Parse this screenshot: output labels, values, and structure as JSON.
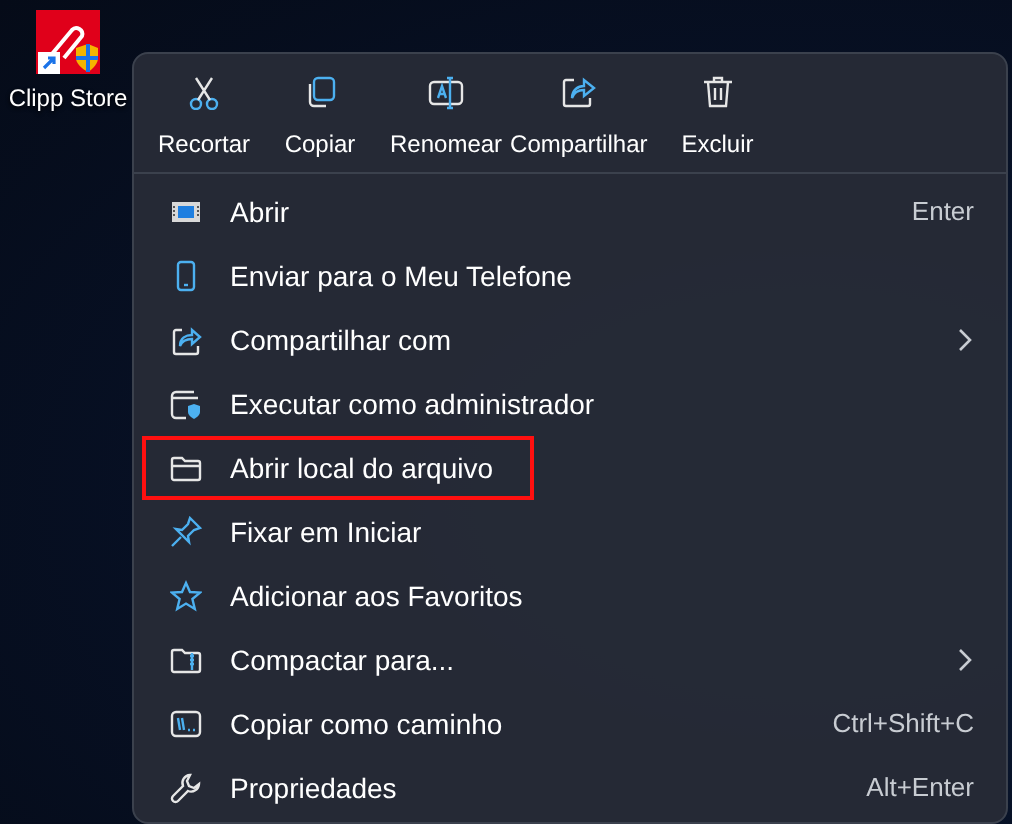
{
  "desktop_icon": {
    "label": "Clipp Store"
  },
  "toolbar": [
    {
      "label": "Recortar"
    },
    {
      "label": "Copiar"
    },
    {
      "label": "Renomear"
    },
    {
      "label": "Compartilhar"
    },
    {
      "label": "Excluir"
    }
  ],
  "menu_items": [
    {
      "label": "Abrir",
      "shortcut": "Enter",
      "submenu": false,
      "highlighted": false
    },
    {
      "label": "Enviar para o Meu Telefone",
      "submenu": false,
      "highlighted": false
    },
    {
      "label": "Compartilhar com",
      "submenu": true,
      "highlighted": false
    },
    {
      "label": "Executar como administrador",
      "submenu": false,
      "highlighted": false
    },
    {
      "label": "Abrir local do arquivo",
      "submenu": false,
      "highlighted": true
    },
    {
      "label": "Fixar em Iniciar",
      "submenu": false,
      "highlighted": false
    },
    {
      "label": "Adicionar aos Favoritos",
      "submenu": false,
      "highlighted": false
    },
    {
      "label": "Compactar para...",
      "submenu": true,
      "highlighted": false
    },
    {
      "label": "Copiar como caminho",
      "shortcut": "Ctrl+Shift+C",
      "submenu": false,
      "highlighted": false
    },
    {
      "label": "Propriedades",
      "shortcut": "Alt+Enter",
      "submenu": false,
      "highlighted": false
    }
  ]
}
